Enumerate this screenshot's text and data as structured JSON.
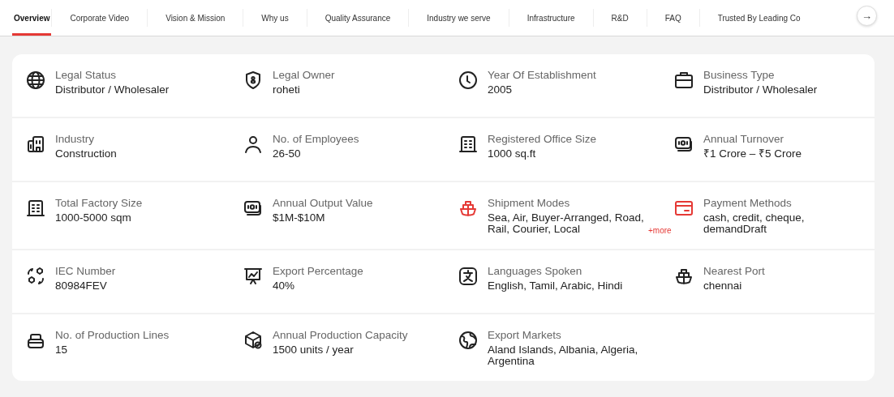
{
  "tabs": [
    {
      "label": "Overview",
      "selected": true
    },
    {
      "label": "Corporate Video",
      "selected": false
    },
    {
      "label": "Vision & Mission",
      "selected": false
    },
    {
      "label": "Why us",
      "selected": false
    },
    {
      "label": "Quality Assurance",
      "selected": false
    },
    {
      "label": "Industry we serve",
      "selected": false
    },
    {
      "label": "Infrastructure",
      "selected": false
    },
    {
      "label": "R&D",
      "selected": false
    },
    {
      "label": "FAQ",
      "selected": false
    },
    {
      "label": "Trusted By Leading Co",
      "selected": false
    }
  ],
  "next_button": "→",
  "items": [
    {
      "kind": "globe",
      "label": "Legal Status",
      "value": "Distributor / Wholesaler",
      "color": "#222222"
    },
    {
      "kind": "shield",
      "label": "Legal Owner",
      "value": "roheti",
      "color": "#222222"
    },
    {
      "kind": "clock",
      "label": "Year Of Establishment",
      "value": "2005",
      "color": "#222222"
    },
    {
      "kind": "briefcase",
      "label": "Business Type",
      "value": "Distributor / Wholesaler",
      "color": "#222222"
    },
    {
      "kind": "building",
      "label": "Industry",
      "value": "Construction",
      "color": "#222222"
    },
    {
      "kind": "person",
      "label": "No. of Employees",
      "value": "26-50",
      "color": "#222222"
    },
    {
      "kind": "office",
      "label": "Registered Office Size",
      "value": "1000 sq.ft",
      "color": "#222222"
    },
    {
      "kind": "money",
      "label": "Annual Turnover",
      "value": "₹1 Crore – ₹5 Crore",
      "color": "#222222"
    },
    {
      "kind": "office",
      "label": "Total Factory Size",
      "value": "1000-5000 sqm",
      "color": "#222222"
    },
    {
      "kind": "money",
      "label": "Annual Output Value",
      "value": "$1M-$10M",
      "color": "#222222"
    },
    {
      "kind": "ship",
      "label": "Shipment Modes",
      "value": "Sea, Air, Buyer-Arranged, Road, Rail, Courier, Local",
      "more": "+more",
      "color": "#e53935"
    },
    {
      "kind": "card",
      "label": "Payment Methods",
      "value": "cash, credit, cheque, demandDraft",
      "color": "#e53935"
    },
    {
      "kind": "exchange",
      "label": "IEC Number",
      "value": "80984FEV",
      "color": "#222222"
    },
    {
      "kind": "chart",
      "label": "Export Percentage",
      "value": "40%",
      "color": "#222222"
    },
    {
      "kind": "translate",
      "label": "Languages Spoken",
      "value": "English, Tamil, Arabic, Hindi",
      "color": "#222222"
    },
    {
      "kind": "ship",
      "label": "Nearest Port",
      "value": "chennai",
      "color": "#222222"
    },
    {
      "kind": "stack",
      "label": "No. of Production Lines",
      "value": "15",
      "color": "#222222"
    },
    {
      "kind": "box",
      "label": "Annual Production Capacity",
      "value": "1500 units / year",
      "color": "#222222"
    },
    {
      "kind": "earth",
      "label": "Export Markets",
      "value": "Aland Islands, Albania, Algeria, Argentina",
      "color": "#222222"
    }
  ]
}
